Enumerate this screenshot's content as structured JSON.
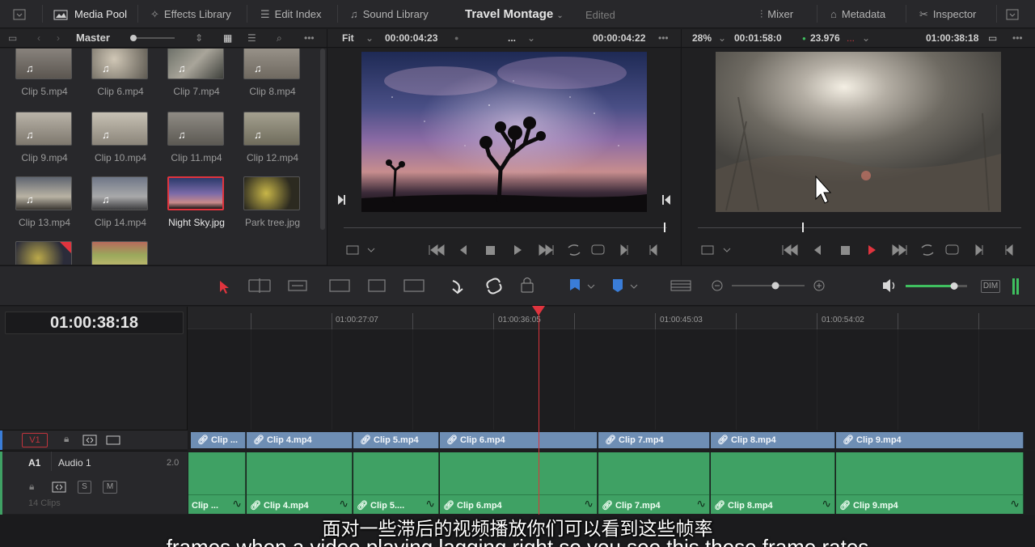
{
  "topbar": {
    "media_pool": "Media Pool",
    "effects_library": "Effects Library",
    "edit_index": "Edit Index",
    "sound_library": "Sound Library",
    "project_title": "Travel Montage",
    "project_status": "Edited",
    "mixer": "Mixer",
    "metadata": "Metadata",
    "inspector": "Inspector"
  },
  "subbar": {
    "bin_name": "Master",
    "source_zoom": "Fit",
    "source_timecode_left": "00:00:04:23",
    "source_clip_menu": "...",
    "source_timecode_right": "00:00:04:22",
    "timeline_zoom": "28%",
    "timeline_duration": "00:01:58:0",
    "framerate": "23.976",
    "framerate_menu": "...",
    "timeline_timecode": "01:00:38:18"
  },
  "media_pool": {
    "clips": [
      {
        "name": "Clip 5.mp4",
        "type": "audio-video"
      },
      {
        "name": "Clip 6.mp4",
        "type": "audio-video"
      },
      {
        "name": "Clip 7.mp4",
        "type": "audio-video"
      },
      {
        "name": "Clip 8.mp4",
        "type": "audio-video"
      },
      {
        "name": "Clip 9.mp4",
        "type": "audio-video"
      },
      {
        "name": "Clip 10.mp4",
        "type": "audio-video"
      },
      {
        "name": "Clip 11.mp4",
        "type": "audio-video"
      },
      {
        "name": "Clip 12.mp4",
        "type": "audio-video"
      },
      {
        "name": "Clip 13.mp4",
        "type": "audio-video"
      },
      {
        "name": "Clip 14.mp4",
        "type": "audio-video"
      },
      {
        "name": "Night Sky.jpg",
        "type": "still",
        "selected": true
      },
      {
        "name": "Park tree.jpg",
        "type": "still"
      }
    ]
  },
  "timeline": {
    "current_timecode": "01:00:38:18",
    "ruler_labels": [
      "01:00:27:07",
      "01:00:36:05",
      "01:00:45:03",
      "01:00:54:02"
    ],
    "v1": {
      "label": "V1"
    },
    "a1": {
      "label": "A1",
      "name": "Audio 1",
      "level": "2.0",
      "clip_count": "14 Clips",
      "solo": "S",
      "mute": "M"
    },
    "video_clips": [
      "Clip ...",
      "Clip 4.mp4",
      "Clip 5.mp4",
      "Clip 6.mp4",
      "Clip 7.mp4",
      "Clip 8.mp4",
      "Clip 9.mp4"
    ],
    "audio_clips": [
      "Clip ...",
      "Clip 4.mp4",
      "Clip 5....",
      "Clip 6.mp4",
      "Clip 7.mp4",
      "Clip 8.mp4",
      "Clip 9.mp4"
    ]
  },
  "toolbar": {
    "dim_label": "DIM"
  },
  "subtitles": {
    "zh": "面对一些滞后的视频播放你们可以看到这些帧率",
    "en": "frames when a video playing lagging right so you see this these frame rates"
  },
  "colors": {
    "accent_red": "#e0343e",
    "video_clip": "#6e8eb4",
    "audio_clip": "#3fa164",
    "volume_green": "#3fbf5f"
  }
}
